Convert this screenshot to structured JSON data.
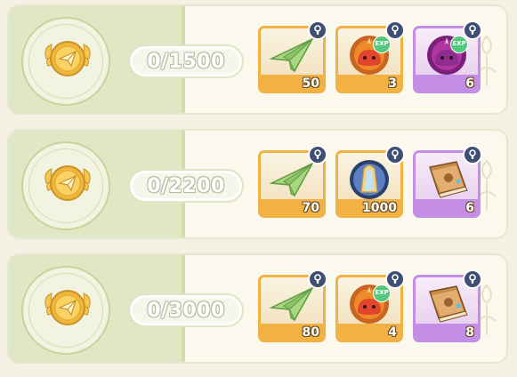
{
  "rows": [
    {
      "progress_text": "0/1500",
      "items": [
        {
          "name": "paper-plane",
          "qty": "50",
          "rarity": "orange",
          "exp": false
        },
        {
          "name": "red-slime-exp",
          "qty": "3",
          "rarity": "orange",
          "exp": true,
          "exp_label": "EXP"
        },
        {
          "name": "purple-slime-exp",
          "qty": "6",
          "rarity": "purple",
          "exp": true,
          "exp_label": "EXP"
        }
      ]
    },
    {
      "progress_text": "0/2200",
      "items": [
        {
          "name": "paper-plane",
          "qty": "70",
          "rarity": "orange",
          "exp": false
        },
        {
          "name": "crystal-orb",
          "qty": "1000",
          "rarity": "orange",
          "exp": false
        },
        {
          "name": "skill-book",
          "qty": "6",
          "rarity": "purple",
          "exp": false
        }
      ]
    },
    {
      "progress_text": "0/3000",
      "items": [
        {
          "name": "paper-plane",
          "qty": "80",
          "rarity": "orange",
          "exp": false
        },
        {
          "name": "red-slime-exp",
          "qty": "4",
          "rarity": "orange",
          "exp": true,
          "exp_label": "EXP"
        },
        {
          "name": "skill-book",
          "qty": "8",
          "rarity": "purple",
          "exp": false
        }
      ]
    }
  ],
  "colors": {
    "orange_frame": "#f2b243",
    "purple_frame": "#c48ee6",
    "lock_badge": "#3e4f73",
    "exp_badge": "#52c77d",
    "panel_green": "#dfe7c4"
  },
  "icons": [
    "medal-paper-plane-icon",
    "lock-icon",
    "exp-badge-icon"
  ]
}
